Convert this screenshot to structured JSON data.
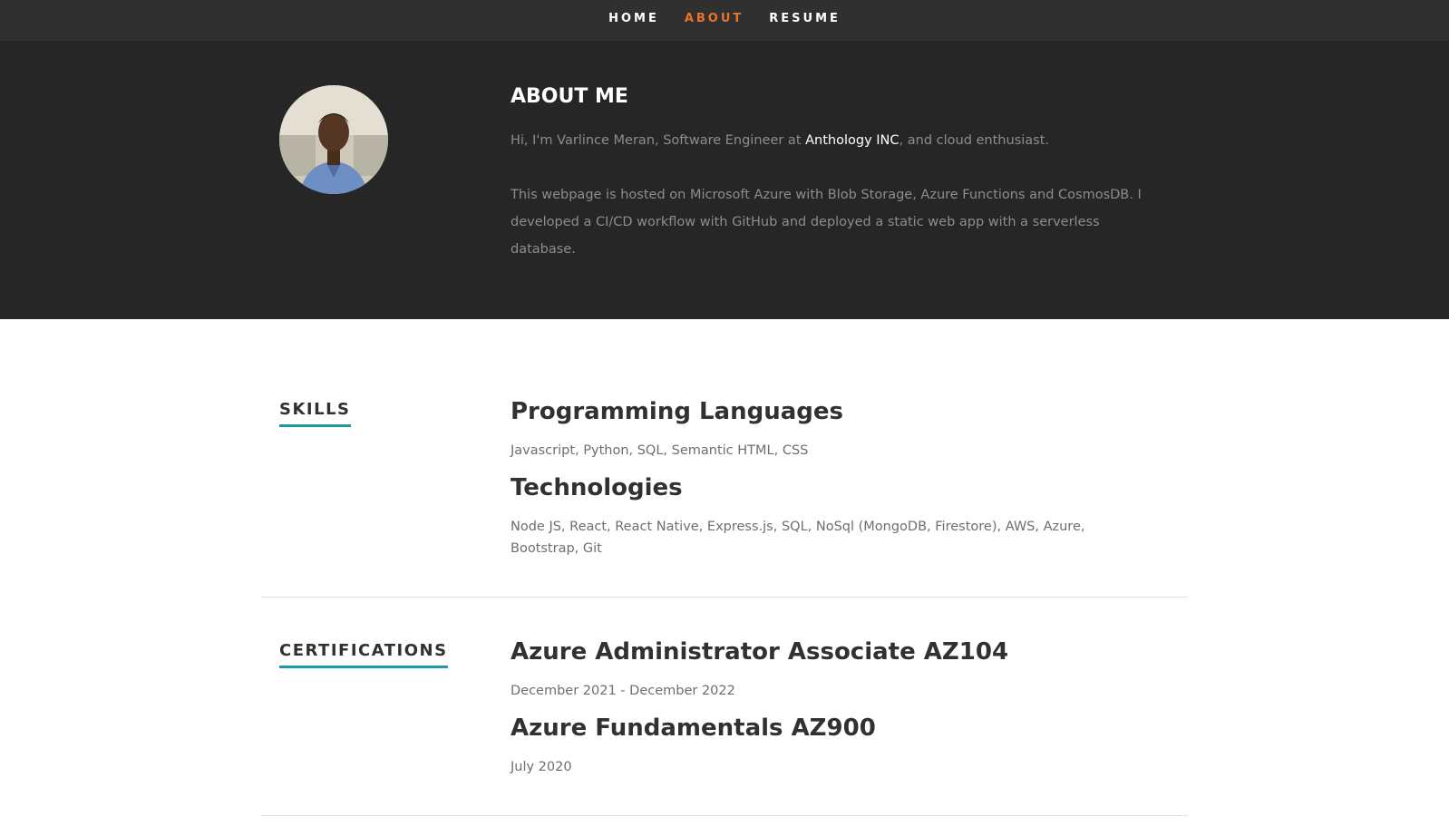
{
  "nav": {
    "items": [
      {
        "label": "HOME",
        "active": false
      },
      {
        "label": "ABOUT",
        "active": true
      },
      {
        "label": "RESUME",
        "active": false
      }
    ],
    "active_color": "#e8732d"
  },
  "about": {
    "title": "ABOUT ME",
    "intro_before": "Hi, I'm Varlince Meran, Software Engineer at ",
    "company": "Anthology INC",
    "intro_after": ", and cloud enthusiast.",
    "hosting_text": "This webpage is hosted on Microsoft Azure with Blob Storage, Azure Functions and CosmosDB. I developed a CI/CD workflow with GitHub and deployed a static web app with a serverless database."
  },
  "skills": {
    "label": "SKILLS",
    "items": [
      {
        "heading": "Programming Languages",
        "text": "Javascript, Python, SQL, Semantic HTML, CSS"
      },
      {
        "heading": "Technologies",
        "text": "Node JS, React, React Native, Express.js, SQL, NoSql (MongoDB, Firestore), AWS, Azure, Bootstrap, Git"
      }
    ]
  },
  "certifications": {
    "label": "CERTIFICATIONS",
    "items": [
      {
        "heading": "Azure Administrator Associate AZ104",
        "text": "December 2021 - December 2022"
      },
      {
        "heading": "Azure Fundamentals AZ900",
        "text": "July 2020"
      }
    ]
  },
  "accent_color": "#1f9aa5"
}
